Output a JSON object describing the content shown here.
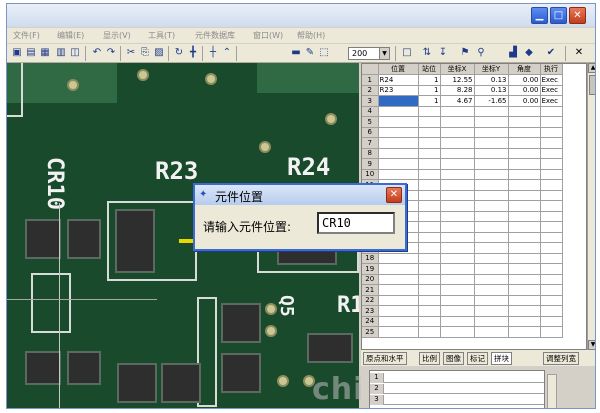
{
  "window": {
    "title": "",
    "controls": [
      "minimize-icon",
      "maximize-icon",
      "close-icon"
    ]
  },
  "menu": [
    {
      "label": "文件(F)"
    },
    {
      "label": "编辑(E)"
    },
    {
      "label": "显示(V)"
    },
    {
      "label": "工具(T)"
    },
    {
      "label": "元件数据库"
    },
    {
      "label": "窗口(W)"
    },
    {
      "label": "帮助(H)"
    }
  ],
  "toolbar": {
    "zoom_value": "200",
    "icons": [
      "open-icon",
      "save-icon",
      "folder-icon",
      "print-icon",
      "preview-icon",
      "undo-icon",
      "redo-icon",
      "cut-icon",
      "copy-icon",
      "paste-icon",
      "rotate-icon",
      "crosshair-icon",
      "origin-icon",
      "probe-icon",
      "chip-icon",
      "measure-icon",
      "select-icon",
      "new-page-icon",
      "sort-icon",
      "sort-az-icon",
      "flag-icon",
      "find-icon",
      "export-icon",
      "import-icon",
      "checkmark-icon",
      "close-icon"
    ]
  },
  "board": {
    "labels": [
      "CR10",
      "R23",
      "R24",
      "Q5",
      "R1"
    ]
  },
  "grid": {
    "columns": [
      "",
      "位置",
      "站位",
      "坐标X",
      "坐标Y",
      "角度",
      "执行"
    ],
    "rows": [
      {
        "n": "1",
        "pos": "R24",
        "station": "1",
        "x": "12.55",
        "y": "0.13",
        "angle": "0.00",
        "exec": "Exec"
      },
      {
        "n": "2",
        "pos": "R23",
        "station": "1",
        "x": "8.28",
        "y": "0.13",
        "angle": "0.00",
        "exec": "Exec"
      },
      {
        "n": "3",
        "pos": "",
        "station": "1",
        "x": "4.67",
        "y": "-1.65",
        "angle": "0.00",
        "exec": "Exec"
      },
      {
        "n": "4"
      },
      {
        "n": "5"
      },
      {
        "n": "6"
      },
      {
        "n": "7"
      },
      {
        "n": "8"
      },
      {
        "n": "9"
      },
      {
        "n": "10"
      },
      {
        "n": "11"
      },
      {
        "n": "12"
      },
      {
        "n": "13"
      },
      {
        "n": "14"
      },
      {
        "n": "15"
      },
      {
        "n": "16"
      },
      {
        "n": "17"
      },
      {
        "n": "18"
      },
      {
        "n": "19"
      },
      {
        "n": "20"
      },
      {
        "n": "21"
      },
      {
        "n": "22"
      },
      {
        "n": "23"
      },
      {
        "n": "24"
      },
      {
        "n": "25"
      }
    ]
  },
  "tabs": [
    {
      "label": "原点和水平"
    },
    {
      "label": "比例"
    },
    {
      "label": "图像"
    },
    {
      "label": "标记"
    },
    {
      "label": "拼块"
    },
    {
      "label": "调整列宽"
    }
  ],
  "mini_grid": {
    "rows": [
      "1",
      "2",
      "3"
    ]
  },
  "dialog": {
    "title": "元件位置",
    "prompt": "请输入元件位置:",
    "input_value": "CR10"
  },
  "watermark": "chi"
}
